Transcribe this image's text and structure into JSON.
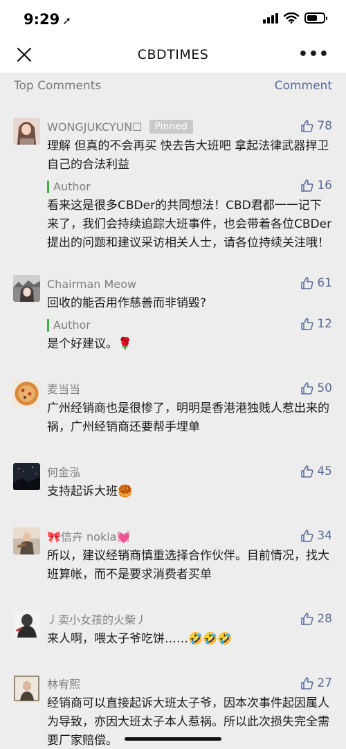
{
  "status": {
    "time": "9:29",
    "location_icon": "location-arrow-icon"
  },
  "nav": {
    "title": "CBDTIMES",
    "more": "•••"
  },
  "header": {
    "label": "Top Comments",
    "action": "Comment"
  },
  "comments": [
    {
      "name": "WONGJUKCYUN☐",
      "pinned": "Pinned",
      "likes": "78",
      "text": "理解 但真的不会再买 快去告大班吧 拿起法律武器捍卫自己的合法利益",
      "reply": {
        "label": "Author",
        "likes": "16",
        "text": "看来这是很多CBDer的共同想法！CBD君都一一记下来了，我们会持续追踪大班事件，也会带着各位CBDer提出的问题和建议采访相关人士，请各位持续关注哦！"
      }
    },
    {
      "name": "Chairman Meow",
      "likes": "61",
      "text": "回收的能否用作慈善而非销毁?",
      "reply": {
        "label": "Author",
        "likes": "12",
        "text": "是个好建议。🌹"
      }
    },
    {
      "name": "麦当当",
      "likes": "50",
      "text": "广州经销商也是很惨了，明明是香港港独贱人惹出来的祸，广州经销商还要帮手埋单"
    },
    {
      "name": "何金泓",
      "likes": "45",
      "text": "支持起诉大班🥮"
    },
    {
      "name": "🎀信卉 nokia💓",
      "likes": "34",
      "text": "所以，建议经销商慎重选择合作伙伴。目前情况，找大班算帐，而不是要求消费者买单"
    },
    {
      "name": "丿卖小女孩的火柴丿",
      "likes": "28",
      "text": "来人啊，喂太子爷吃饼……🤣🤣🤣"
    },
    {
      "name": "林宥熙",
      "likes": "27",
      "text": "经销商可以直接起诉大班太子爷，因本次事件起因属人为导致，亦因大班太子本人惹祸。所以此次损失完全需要厂家赔偿。"
    }
  ],
  "colors": {
    "link": "#576b95",
    "author_bar": "#3cb043",
    "background": "#ededed"
  }
}
